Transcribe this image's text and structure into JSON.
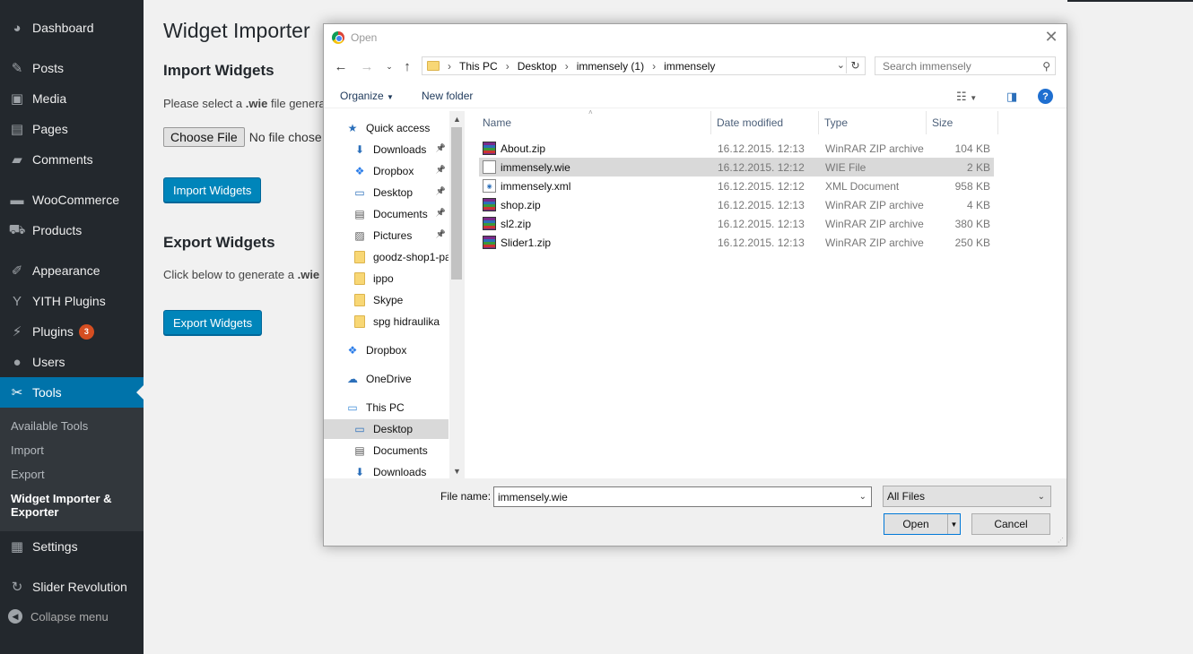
{
  "sidebar": {
    "items": [
      {
        "label": "Dashboard",
        "icon": "dashboard-icon",
        "glyph": "◕"
      },
      {
        "label": "Posts",
        "icon": "pin-icon",
        "glyph": "✎"
      },
      {
        "label": "Media",
        "icon": "media-icon",
        "glyph": "▣"
      },
      {
        "label": "Pages",
        "icon": "pages-icon",
        "glyph": "▤"
      },
      {
        "label": "Comments",
        "icon": "comments-icon",
        "glyph": "▰"
      },
      {
        "label": "WooCommerce",
        "icon": "woo-icon",
        "glyph": "▬"
      },
      {
        "label": "Products",
        "icon": "cart-icon",
        "glyph": "⛟"
      },
      {
        "label": "Appearance",
        "icon": "brush-icon",
        "glyph": "✐"
      },
      {
        "label": "YITH Plugins",
        "icon": "yith-icon",
        "glyph": "Y"
      },
      {
        "label": "Plugins",
        "icon": "plugin-icon",
        "glyph": "⚡",
        "badge": "3"
      },
      {
        "label": "Users",
        "icon": "users-icon",
        "glyph": "●"
      },
      {
        "label": "Tools",
        "icon": "wrench-icon",
        "glyph": "✂",
        "active": true
      },
      {
        "label": "Settings",
        "icon": "settings-icon",
        "glyph": "▦"
      },
      {
        "label": "Slider Revolution",
        "icon": "refresh-icon",
        "glyph": "↻"
      }
    ],
    "submenu": [
      "Available Tools",
      "Import",
      "Export",
      "Widget Importer &",
      "Exporter"
    ],
    "collapse": "Collapse menu"
  },
  "content": {
    "title": "Widget Importer",
    "import_heading": "Import Widgets",
    "import_text_prefix": "Please select a ",
    "import_text_bold": ".wie",
    "import_text_suffix": " file genera",
    "choose_file": "Choose File",
    "no_file": "No file chose",
    "import_button": "Import Widgets",
    "export_heading": "Export Widgets",
    "export_text_prefix": "Click below to generate a ",
    "export_text_bold": ".wie",
    "export_button": "Export Widgets"
  },
  "dialog": {
    "title": "Open",
    "breadcrumb": [
      "This PC",
      "Desktop",
      "immensely (1)",
      "immensely"
    ],
    "search_placeholder": "Search immensely",
    "organize": "Organize",
    "new_folder": "New folder",
    "nav": [
      {
        "label": "Quick access",
        "icon": "star-icon",
        "level": 0
      },
      {
        "label": "Downloads",
        "icon": "download-icon",
        "level": 1,
        "pinned": true
      },
      {
        "label": "Dropbox",
        "icon": "dropbox-icon",
        "level": 1,
        "pinned": true
      },
      {
        "label": "Desktop",
        "icon": "desktop-icon",
        "level": 1,
        "pinned": true
      },
      {
        "label": "Documents",
        "icon": "documents-icon",
        "level": 1,
        "pinned": true
      },
      {
        "label": "Pictures",
        "icon": "pictures-icon",
        "level": 1,
        "pinned": true
      },
      {
        "label": "goodz-shop1-pa",
        "icon": "folder-icon",
        "level": 1
      },
      {
        "label": "ippo",
        "icon": "folder-icon",
        "level": 1
      },
      {
        "label": "Skype",
        "icon": "folder-icon",
        "level": 1
      },
      {
        "label": "spg hidraulika",
        "icon": "folder-icon",
        "level": 1
      },
      {
        "label": "Dropbox",
        "icon": "dropbox-icon",
        "level": 0
      },
      {
        "label": "OneDrive",
        "icon": "onedrive-icon",
        "level": 0
      },
      {
        "label": "This PC",
        "icon": "computer-icon",
        "level": 0
      },
      {
        "label": "Desktop",
        "icon": "desktop-icon",
        "level": 1,
        "selected": true
      },
      {
        "label": "Documents",
        "icon": "documents-icon",
        "level": 1
      },
      {
        "label": "Downloads",
        "icon": "download-icon",
        "level": 1
      }
    ],
    "columns": [
      "Name",
      "Date modified",
      "Type",
      "Size"
    ],
    "files": [
      {
        "name": "About.zip",
        "date": "16.12.2015. 12:13",
        "type": "WinRAR ZIP archive",
        "size": "104 KB",
        "icon": "rar"
      },
      {
        "name": "immensely.wie",
        "date": "16.12.2015. 12:12",
        "type": "WIE File",
        "size": "2 KB",
        "icon": "wie",
        "selected": true
      },
      {
        "name": "immensely.xml",
        "date": "16.12.2015. 12:12",
        "type": "XML Document",
        "size": "958 KB",
        "icon": "xml"
      },
      {
        "name": "shop.zip",
        "date": "16.12.2015. 12:13",
        "type": "WinRAR ZIP archive",
        "size": "4 KB",
        "icon": "rar"
      },
      {
        "name": "sl2.zip",
        "date": "16.12.2015. 12:13",
        "type": "WinRAR ZIP archive",
        "size": "380 KB",
        "icon": "rar"
      },
      {
        "name": "Slider1.zip",
        "date": "16.12.2015. 12:13",
        "type": "WinRAR ZIP archive",
        "size": "250 KB",
        "icon": "rar"
      }
    ],
    "file_name_label": "File name:",
    "file_name_value": "immensely.wie",
    "filter": "All Files",
    "open_button": "Open",
    "cancel_button": "Cancel"
  }
}
